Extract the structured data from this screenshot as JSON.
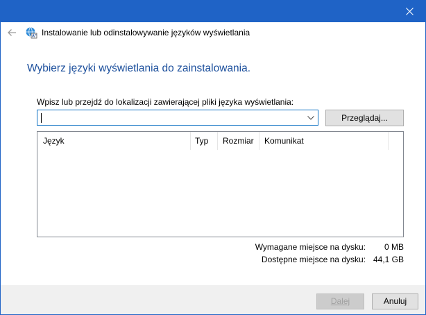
{
  "window": {
    "title": "Instalowanie lub odinstalowywanie języków wyświetlania",
    "accent": "#1f63c6"
  },
  "heading": "Wybierz języki wyświetlania do zainstalowania.",
  "path": {
    "label": "Wpisz lub przejdź do lokalizacji zawierającej pliki języka wyświetlania:",
    "value": ""
  },
  "browse_label": "Przeglądaj...",
  "list": {
    "columns": [
      "Język",
      "Typ",
      "Rozmiar",
      "Komunikat"
    ],
    "rows": []
  },
  "disk": {
    "required_label": "Wymagane miejsce na dysku:",
    "required_value": "0 MB",
    "available_label": "Dostępne miejsce na dysku:",
    "available_value": "44,1 GB"
  },
  "buttons": {
    "next": "Dalej",
    "cancel": "Anuluj"
  }
}
